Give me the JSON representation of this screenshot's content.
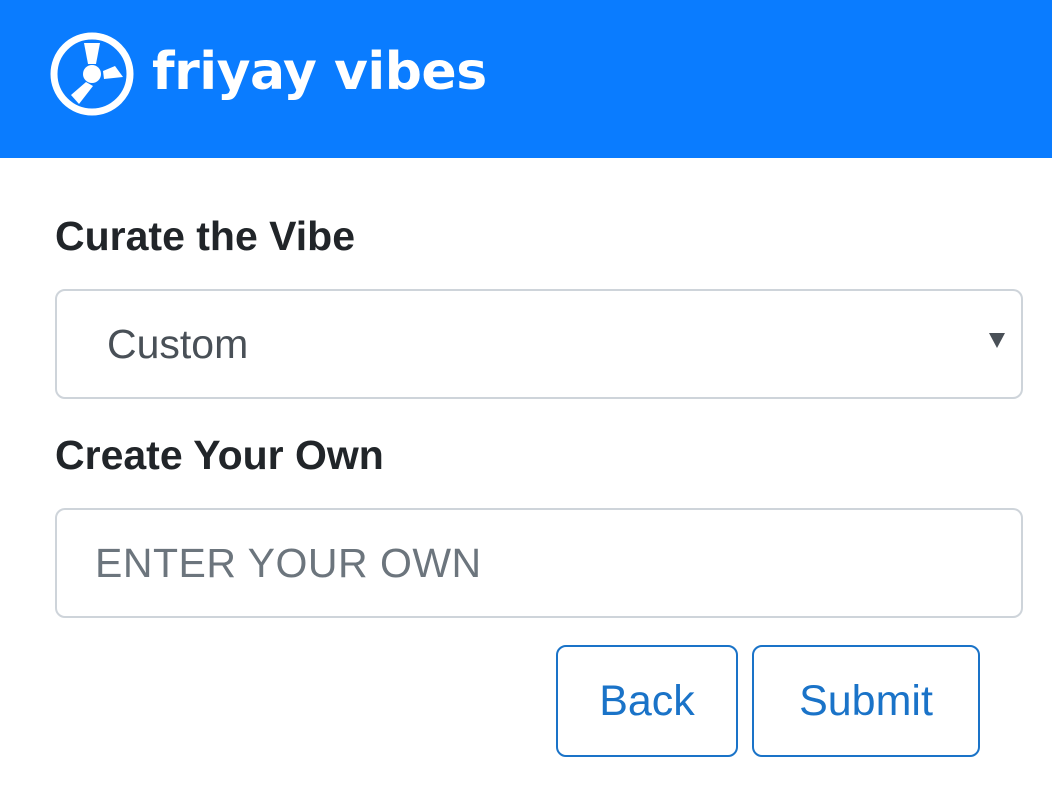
{
  "header": {
    "brand_name": "friyay vibes",
    "logo_icon": "fan-icon",
    "background_color": "#0a7cff"
  },
  "form": {
    "vibe_label": "Curate the Vibe",
    "vibe_select_value": "Custom",
    "own_label": "Create Your Own",
    "own_input_placeholder": "ENTER YOUR OWN",
    "own_input_value": ""
  },
  "buttons": {
    "back_label": "Back",
    "submit_label": "Submit",
    "accent_color": "#1a73c8"
  }
}
